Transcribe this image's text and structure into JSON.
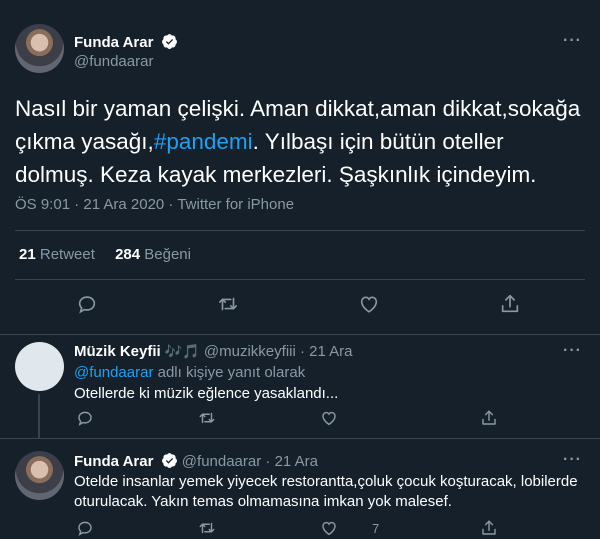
{
  "main_tweet": {
    "author_name": "Funda Arar",
    "author_handle": "@fundaarar",
    "text_part1": "Nasıl bir yaman çelişki. Aman dikkat,aman dikkat,sokağa çıkma yasağı,",
    "hashtag": "#pandemi",
    "text_part2": ". Yılbaşı için bütün oteller dolmuş. Keza kayak merkezleri. Şaşkınlık içindeyim.",
    "meta": "ÖS 9:01 · 21 Ara 2020 · Twitter for iPhone",
    "retweet_count": "21",
    "retweet_label": "Retweet",
    "like_count": "284",
    "like_label": "Beğeni"
  },
  "replies": [
    {
      "author_name": "Müzik Keyfii",
      "author_emoji": "🎶🎵",
      "author_handle": "@muzikkeyfiii",
      "date": "· 21 Ara",
      "replying_to_handle": "@fundaarar",
      "replying_to_suffix": "adlı kişiye yanıt olarak",
      "text": "Otellerde ki müzik eğlence yasaklandı..."
    },
    {
      "author_name": "Funda Arar",
      "author_handle": "@fundaarar",
      "date": "· 21 Ara",
      "text": "Otelde insanlar yemek yiyecek restorantta,çoluk çocuk koşturacak, lobilerde oturulacak. Yakın temas olmamasına imkan yok malesef.",
      "like_count": "7"
    }
  ],
  "colors": {
    "background": "#15202b",
    "accent": "#1da1f2",
    "muted": "#8899a6",
    "divider": "#38444d"
  }
}
